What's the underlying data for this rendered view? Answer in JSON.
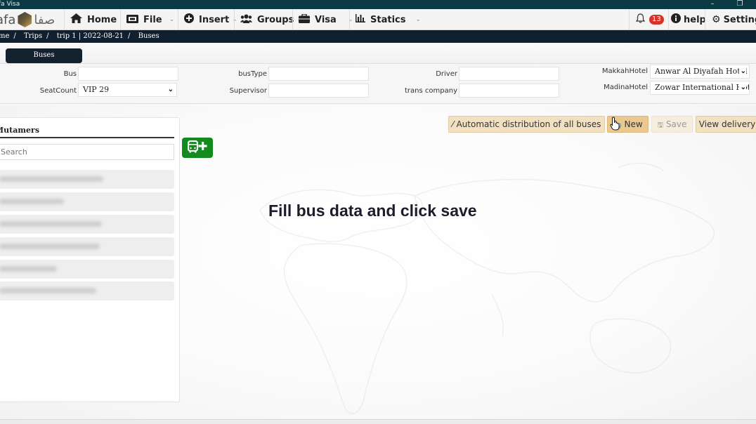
{
  "window": {
    "title": "fa Visa",
    "minimize_icon": "minimize-icon",
    "restore_icon": "restore-icon"
  },
  "navbar": {
    "logo_latin": "afa",
    "logo_arabic": "صفا",
    "items": [
      {
        "label": "Home",
        "icon": "home-icon",
        "has_dropdown": false
      },
      {
        "label": "File",
        "icon": "file-icon",
        "has_dropdown": true
      },
      {
        "label": "Insert",
        "icon": "plus-circle-icon",
        "has_dropdown": true
      },
      {
        "label": "Groups",
        "icon": "users-icon",
        "has_dropdown": true
      },
      {
        "label": "Visa",
        "icon": "briefcase-icon",
        "has_dropdown": true
      },
      {
        "label": "Statics",
        "icon": "bar-chart-icon",
        "has_dropdown": true
      }
    ],
    "notifications_count": "13",
    "help_label": "help",
    "settings_label": "Settings"
  },
  "breadcrumb": [
    "me",
    "Trips",
    "trip 1 | 2022-08-21",
    "Buses"
  ],
  "tabs": {
    "active": "Buses"
  },
  "form": {
    "bus": {
      "label": "Bus",
      "value": ""
    },
    "seat_count": {
      "label": "SeatCount",
      "value": "VIP 29"
    },
    "bus_type": {
      "label": "busType",
      "value": ""
    },
    "supervisor": {
      "label": "Supervisor",
      "value": ""
    },
    "driver": {
      "label": "Driver",
      "value": ""
    },
    "trans_company": {
      "label": "trans company",
      "value": ""
    },
    "makkah_hotel": {
      "label": "MakkahHotel",
      "value": "Anwar Al Diyafah Hotel"
    },
    "madina_hotel": {
      "label": "MadinaHotel",
      "value": "Zowar International Hote"
    }
  },
  "mutamers": {
    "title": "Mutamers",
    "search_placeholder": "Search",
    "items_redacted_count": 6
  },
  "actions": {
    "auto_distribute": "Automatic distribution of all buses",
    "new": "New",
    "save": "Save",
    "view_delivery": "View delivery"
  },
  "main": {
    "hint": "Fill bus data and click save"
  },
  "colors": {
    "titlebar": "#0b3a44",
    "crumbbar": "#11202e",
    "add_bus_green": "#138a1d",
    "badge_red": "#d9322b",
    "action_beige": "#f2e0c1"
  }
}
